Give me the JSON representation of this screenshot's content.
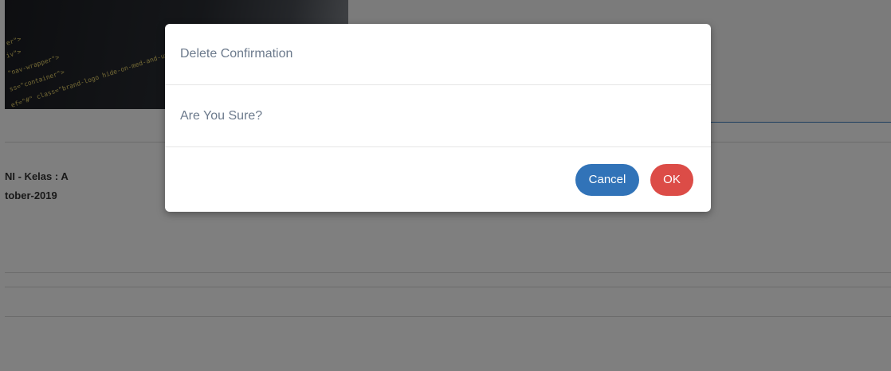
{
  "background": {
    "code_lines": [
      "er\">",
      "iv\">",
      "\"nav-wrapper\">",
      "ss=\"container\">",
      "ef=\"#\" class=\"brand-logo hide-on-med-and-up\">"
    ],
    "course_line": "NI - Kelas : A",
    "date_line": "tober-2019"
  },
  "modal": {
    "title": "Delete Confirmation",
    "message": "Are You Sure?",
    "cancel_label": "Cancel",
    "ok_label": "OK"
  },
  "colors": {
    "cancel_button": "#3173b8",
    "ok_button": "#dc4c47",
    "header_accent": "#3d7fbf",
    "overlay": "rgba(0,0,0,0.5)"
  }
}
